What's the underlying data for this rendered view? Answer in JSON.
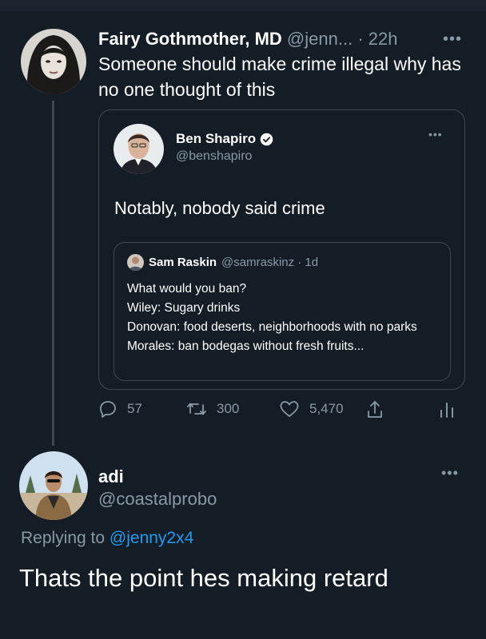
{
  "tweet": {
    "author_name": "Fairy Gothmother, MD",
    "author_handle": "@jenn...",
    "time": "· 22h",
    "more_label": "•••",
    "text": "Someone should make crime illegal why has no one thought of this"
  },
  "quote": {
    "author_name": "Ben Shapiro",
    "author_handle": "@benshapiro",
    "verified": true,
    "more_label": "•••",
    "text": "Notably, nobody said crime",
    "inner": {
      "author_name": "Sam Raskin",
      "meta": "@samraskinz · 1d",
      "lines": [
        "What would you ban?",
        "Wiley: Sugary drinks",
        "Donovan: food deserts, neighborhoods with no parks",
        "Morales: ban bodegas without fresh fruits..."
      ]
    }
  },
  "actions": {
    "replies": "57",
    "retweets": "300",
    "likes": "5,470",
    "icons": [
      "reply-icon",
      "retweet-icon",
      "like-icon",
      "share-icon",
      "analytics-icon"
    ]
  },
  "reply": {
    "author_name": "adi",
    "author_handle": "@coastalprobo",
    "more_label": "•••",
    "replying_prefix": "Replying to",
    "replying_to": "@jenny2x4",
    "text": "Thats the point hes making retard"
  },
  "colors": {
    "background": "#141d26",
    "secondary_text": "#8899a6",
    "link": "#1d9bf0",
    "border": "#3d4a56"
  }
}
